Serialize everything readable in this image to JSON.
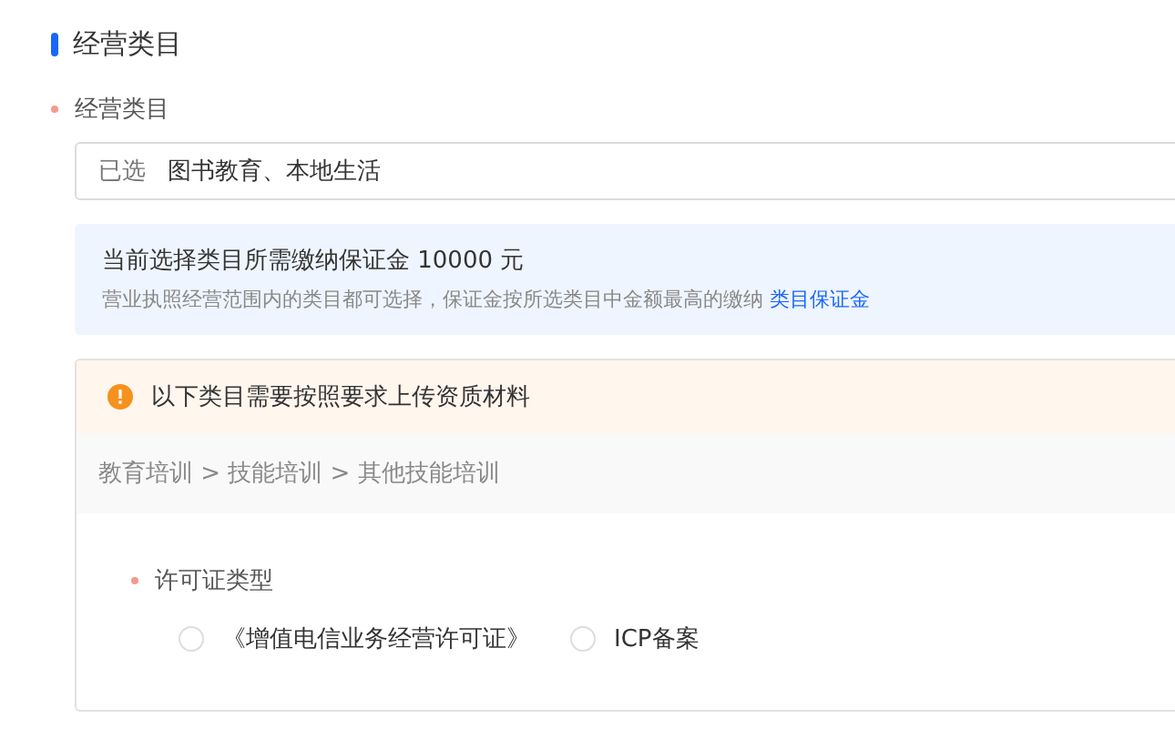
{
  "section_title": "经营类目",
  "category_field": {
    "label": "经营类目",
    "required": true,
    "prefix": "已选",
    "value": "图书教育、本地生活"
  },
  "deposit_notice": {
    "title": "当前选择类目所需缴纳保证金 10000 元",
    "description": "营业执照经营范围内的类目都可选择，保证金按所选类目中金额最高的缴纳",
    "link": "类目保证金"
  },
  "qualification_card": {
    "warning": "以下类目需要按照要求上传资质材料",
    "category_path": "教育培训 > 技能培训 > 其他技能培训",
    "license_field": {
      "label": "许可证类型",
      "required": true,
      "options": [
        {
          "label": "《增值电信业务经营许可证》",
          "selected": false
        },
        {
          "label": "ICP备案",
          "selected": false
        }
      ]
    }
  }
}
